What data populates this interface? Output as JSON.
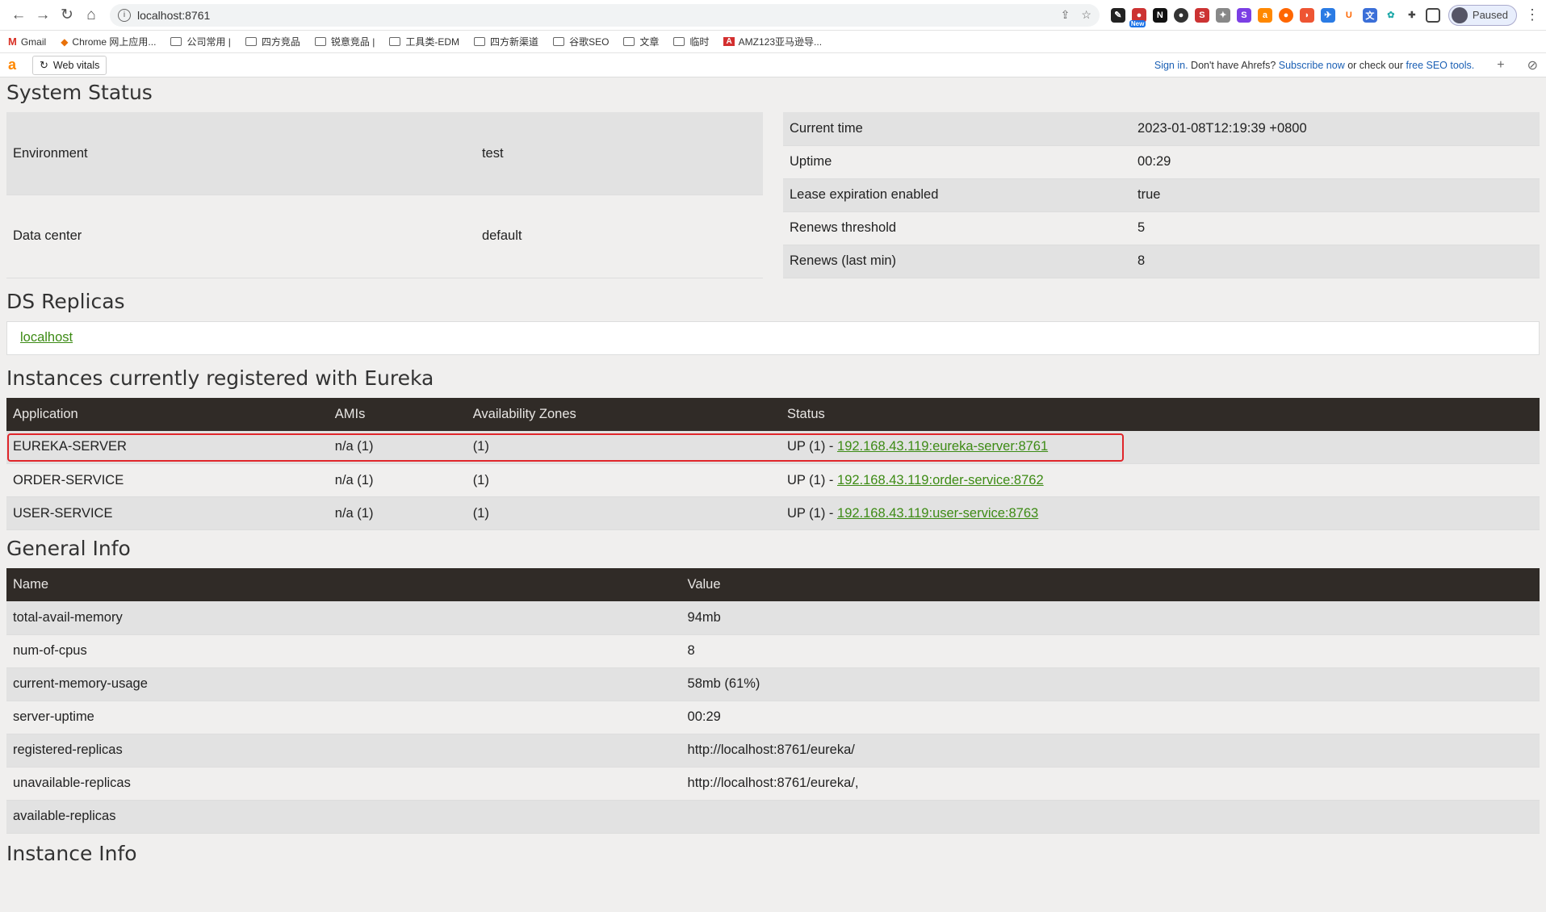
{
  "browser": {
    "url": "localhost:8761",
    "profile_label": "Paused",
    "new_badge": "New",
    "bookmarks": [
      {
        "label": "Gmail",
        "kind": "gmail"
      },
      {
        "label": "Chrome 网上应用...",
        "kind": "chrome"
      },
      {
        "label": "公司常用 |",
        "kind": "folder"
      },
      {
        "label": "四方竞品",
        "kind": "folder"
      },
      {
        "label": "锐意竞品 |",
        "kind": "folder"
      },
      {
        "label": "工具类-EDM",
        "kind": "folder"
      },
      {
        "label": "四方新渠道",
        "kind": "folder"
      },
      {
        "label": "谷歌SEO",
        "kind": "folder"
      },
      {
        "label": "文章",
        "kind": "folder"
      },
      {
        "label": "临时",
        "kind": "folder"
      },
      {
        "label": "AMZ123亚马逊导...",
        "kind": "amz"
      }
    ]
  },
  "ahrefs_bar": {
    "logo": "a",
    "web_vitals": "Web vitals",
    "sign_in": "Sign in.",
    "no_account": " Don't have Ahrefs? ",
    "subscribe": "Subscribe now",
    "or_check": " or check our ",
    "free_tools": "free SEO tools."
  },
  "system_status": {
    "title": "System Status",
    "left": [
      [
        "Environment",
        "test"
      ],
      [
        "Data center",
        "default"
      ]
    ],
    "right": [
      [
        "Current time",
        "2023-01-08T12:19:39 +0800"
      ],
      [
        "Uptime",
        "00:29"
      ],
      [
        "Lease expiration enabled",
        "true"
      ],
      [
        "Renews threshold",
        "5"
      ],
      [
        "Renews (last min)",
        "8"
      ]
    ]
  },
  "ds_replicas": {
    "title": "DS Replicas",
    "link": "localhost"
  },
  "instances": {
    "title": "Instances currently registered with Eureka",
    "headers": [
      "Application",
      "AMIs",
      "Availability Zones",
      "Status"
    ],
    "rows": [
      {
        "app": "EUREKA-SERVER",
        "amis": "n/a (1)",
        "zones": "(1)",
        "status_prefix": "UP (1) - ",
        "status_link": "192.168.43.119:eureka-server:8761",
        "highlighted": true
      },
      {
        "app": "ORDER-SERVICE",
        "amis": "n/a (1)",
        "zones": "(1)",
        "status_prefix": "UP (1) - ",
        "status_link": "192.168.43.119:order-service:8762",
        "highlighted": false
      },
      {
        "app": "USER-SERVICE",
        "amis": "n/a (1)",
        "zones": "(1)",
        "status_prefix": "UP (1) - ",
        "status_link": "192.168.43.119:user-service:8763",
        "highlighted": false
      }
    ]
  },
  "general_info": {
    "title": "General Info",
    "headers": [
      "Name",
      "Value"
    ],
    "rows": [
      [
        "total-avail-memory",
        "94mb"
      ],
      [
        "num-of-cpus",
        "8"
      ],
      [
        "current-memory-usage",
        "58mb (61%)"
      ],
      [
        "server-uptime",
        "00:29"
      ],
      [
        "registered-replicas",
        "http://localhost:8761/eureka/"
      ],
      [
        "unavailable-replicas",
        "http://localhost:8761/eureka/,"
      ],
      [
        "available-replicas",
        ""
      ]
    ]
  },
  "instance_info": {
    "title": "Instance Info"
  },
  "colors": {
    "header_bg": "#302b27",
    "link": "#3d8b15",
    "highlight": "#e0262b"
  }
}
